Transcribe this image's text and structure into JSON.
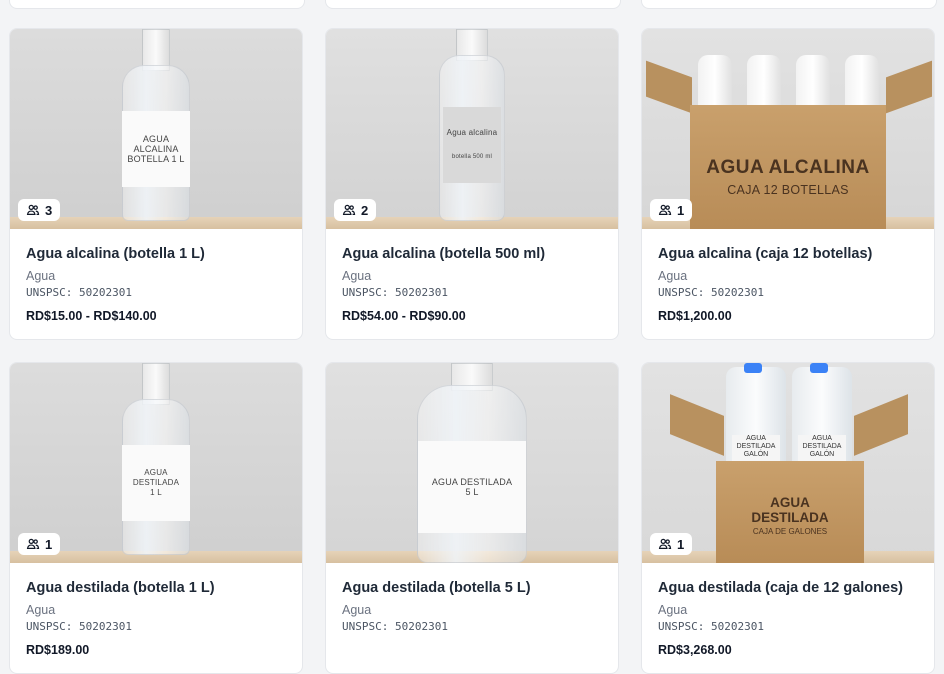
{
  "products": [
    {
      "name": "Agua alcalina (botella 1 L)",
      "category": "Agua",
      "code": "UNSPSC: 50202301",
      "price": "RD$15.00 - RD$140.00",
      "suppliers": "3",
      "label_line1": "AGUA ALCALINA",
      "label_line2": "BOTELLA 1 L"
    },
    {
      "name": "Agua alcalina (botella 500 ml)",
      "category": "Agua",
      "code": "UNSPSC: 50202301",
      "price": "RD$54.00 - RD$90.00",
      "suppliers": "2",
      "label_line1": "Agua alcalina",
      "label_line2": "botella 500 ml"
    },
    {
      "name": "Agua alcalina (caja 12 botellas)",
      "category": "Agua",
      "code": "UNSPSC: 50202301",
      "price": "RD$1,200.00",
      "suppliers": "1",
      "label_line1": "AGUA ALCALINA",
      "label_line2": "CAJA 12 BOTELLAS"
    },
    {
      "name": "Agua destilada (botella 1 L)",
      "category": "Agua",
      "code": "UNSPSC: 50202301",
      "price": "RD$189.00",
      "suppliers": "1",
      "label_line1": "AGUA DESTILADA",
      "label_line2": "1 L"
    },
    {
      "name": "Agua destilada (botella 5 L)",
      "category": "Agua",
      "code": "UNSPSC: 50202301",
      "price": "",
      "suppliers": "",
      "label_line1": "AGUA DESTILADA",
      "label_line2": "5 L"
    },
    {
      "name": "Agua destilada (caja de 12 galones)",
      "category": "Agua",
      "code": "UNSPSC: 50202301",
      "price": "RD$3,268.00",
      "suppliers": "1",
      "label_line1": "AGUA",
      "label_line2": "DESTILADA",
      "label_line3": "CAJA DE GALONES",
      "jug_label_1": "AGUA",
      "jug_label_2": "DESTILADA",
      "jug_label_3": "GALÓN"
    }
  ],
  "colors": {
    "background": "#f3f4f6",
    "card": "#ffffff",
    "title": "#1f2937",
    "muted": "#6b7280"
  },
  "icons": {
    "suppliers": "users-icon"
  }
}
